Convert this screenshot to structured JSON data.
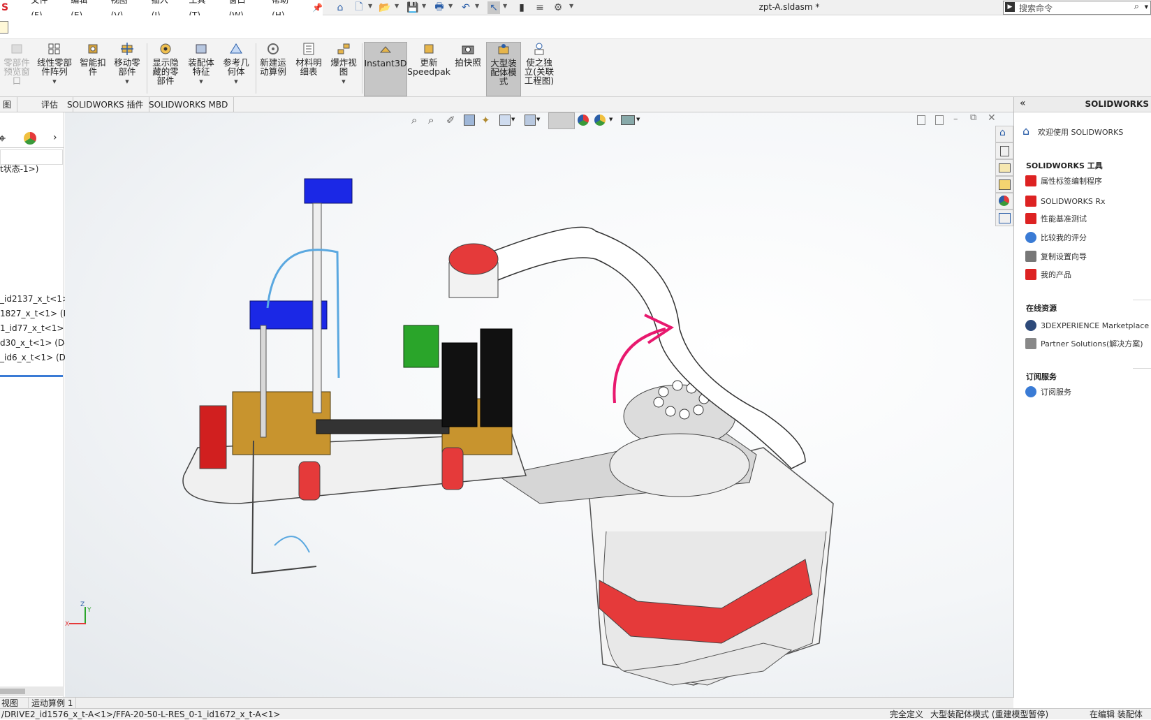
{
  "app": {
    "logo_text": "S",
    "document_title": "zpt-A.sldasm *",
    "search_placeholder": "搜索命令"
  },
  "menu": [
    "文件(F)",
    "编辑(E)",
    "视图(V)",
    "插入(I)",
    "工具(T)",
    "窗口(W)",
    "帮助(H)"
  ],
  "commands": [
    {
      "label": "零部件\n预览窗\n口",
      "disabled": true
    },
    {
      "label": "线性零部\n件阵列"
    },
    {
      "label": "智能扣\n件"
    },
    {
      "label": "移动零\n部件"
    },
    {
      "label": "显示隐\n藏的零\n部件"
    },
    {
      "label": "装配体\n特征"
    },
    {
      "label": "参考几\n何体"
    },
    {
      "label": "新建运\n动算例"
    },
    {
      "label": "材料明\n细表"
    },
    {
      "label": "爆炸视\n图"
    },
    {
      "label": "Instant3D",
      "active": true
    },
    {
      "label": "更新\nSpeedpak"
    },
    {
      "label": "拍快照"
    },
    {
      "label": "大型装\n配体模\n式",
      "active": true
    },
    {
      "label": "使之独\n立(关联\n工程图)"
    }
  ],
  "tabs": [
    "图",
    "评估",
    "SOLIDWORKS 插件",
    "SOLIDWORKS MBD"
  ],
  "tree": {
    "config": "t状态-1>)",
    "items": [
      "_id2137_x_t<1>",
      "1827_x_t<1> (D",
      "1_id77_x_t<1> (",
      "d30_x_t<1> (De",
      "_id6_x_t<1> (De"
    ]
  },
  "taskpane": {
    "title": "SOLIDWORKS",
    "welcome": "欢迎使用 SOLIDWORKS",
    "tools_header": "SOLIDWORKS 工具",
    "tools": [
      "属性标签编制程序",
      "SOLIDWORKS Rx",
      "性能基准测试",
      "比较我的评分",
      "复制设置向导",
      "我的产品"
    ],
    "online_header": "在线资源",
    "online": [
      "3DEXPERIENCE Marketplace",
      "Partner Solutions(解决方案)"
    ],
    "subscription_header": "订阅服务",
    "subscription": [
      "订阅服务"
    ]
  },
  "bottom_tabs": [
    "视图",
    "运动算例 1"
  ],
  "status": {
    "path": "/DRIVE2_id1576_x_t-A<1>/FFA-20-50-L-RES_0-1_id1672_x_t-A<1>",
    "state": "完全定义",
    "mode": "大型装配体模式 (重建模型暂停)",
    "edit": "在编辑 装配体"
  },
  "triad": {
    "x": "X",
    "y": "Y",
    "z": "Z"
  },
  "colors": {
    "accent": "#2a5ea8",
    "robot_red": "#e53a3a",
    "gripper_blue": "#1b28e6",
    "bracket_gold": "#c8942e",
    "annotation_pink": "#e8186e"
  }
}
